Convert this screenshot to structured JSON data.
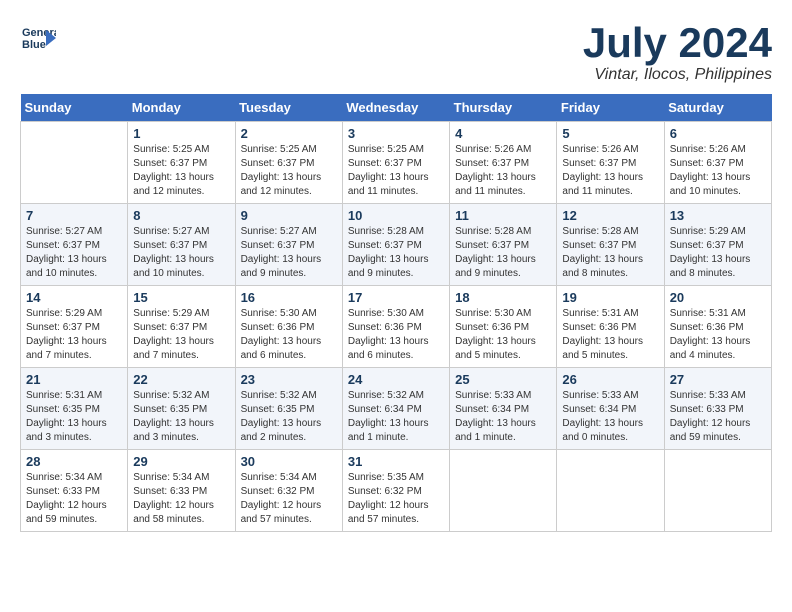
{
  "header": {
    "logo_line1": "General",
    "logo_line2": "Blue",
    "month_year": "July 2024",
    "location": "Vintar, Ilocos, Philippines"
  },
  "days_of_week": [
    "Sunday",
    "Monday",
    "Tuesday",
    "Wednesday",
    "Thursday",
    "Friday",
    "Saturday"
  ],
  "weeks": [
    [
      {
        "day": "",
        "info": ""
      },
      {
        "day": "1",
        "info": "Sunrise: 5:25 AM\nSunset: 6:37 PM\nDaylight: 13 hours\nand 12 minutes."
      },
      {
        "day": "2",
        "info": "Sunrise: 5:25 AM\nSunset: 6:37 PM\nDaylight: 13 hours\nand 12 minutes."
      },
      {
        "day": "3",
        "info": "Sunrise: 5:25 AM\nSunset: 6:37 PM\nDaylight: 13 hours\nand 11 minutes."
      },
      {
        "day": "4",
        "info": "Sunrise: 5:26 AM\nSunset: 6:37 PM\nDaylight: 13 hours\nand 11 minutes."
      },
      {
        "day": "5",
        "info": "Sunrise: 5:26 AM\nSunset: 6:37 PM\nDaylight: 13 hours\nand 11 minutes."
      },
      {
        "day": "6",
        "info": "Sunrise: 5:26 AM\nSunset: 6:37 PM\nDaylight: 13 hours\nand 10 minutes."
      }
    ],
    [
      {
        "day": "7",
        "info": "Sunrise: 5:27 AM\nSunset: 6:37 PM\nDaylight: 13 hours\nand 10 minutes."
      },
      {
        "day": "8",
        "info": "Sunrise: 5:27 AM\nSunset: 6:37 PM\nDaylight: 13 hours\nand 10 minutes."
      },
      {
        "day": "9",
        "info": "Sunrise: 5:27 AM\nSunset: 6:37 PM\nDaylight: 13 hours\nand 9 minutes."
      },
      {
        "day": "10",
        "info": "Sunrise: 5:28 AM\nSunset: 6:37 PM\nDaylight: 13 hours\nand 9 minutes."
      },
      {
        "day": "11",
        "info": "Sunrise: 5:28 AM\nSunset: 6:37 PM\nDaylight: 13 hours\nand 9 minutes."
      },
      {
        "day": "12",
        "info": "Sunrise: 5:28 AM\nSunset: 6:37 PM\nDaylight: 13 hours\nand 8 minutes."
      },
      {
        "day": "13",
        "info": "Sunrise: 5:29 AM\nSunset: 6:37 PM\nDaylight: 13 hours\nand 8 minutes."
      }
    ],
    [
      {
        "day": "14",
        "info": "Sunrise: 5:29 AM\nSunset: 6:37 PM\nDaylight: 13 hours\nand 7 minutes."
      },
      {
        "day": "15",
        "info": "Sunrise: 5:29 AM\nSunset: 6:37 PM\nDaylight: 13 hours\nand 7 minutes."
      },
      {
        "day": "16",
        "info": "Sunrise: 5:30 AM\nSunset: 6:36 PM\nDaylight: 13 hours\nand 6 minutes."
      },
      {
        "day": "17",
        "info": "Sunrise: 5:30 AM\nSunset: 6:36 PM\nDaylight: 13 hours\nand 6 minutes."
      },
      {
        "day": "18",
        "info": "Sunrise: 5:30 AM\nSunset: 6:36 PM\nDaylight: 13 hours\nand 5 minutes."
      },
      {
        "day": "19",
        "info": "Sunrise: 5:31 AM\nSunset: 6:36 PM\nDaylight: 13 hours\nand 5 minutes."
      },
      {
        "day": "20",
        "info": "Sunrise: 5:31 AM\nSunset: 6:36 PM\nDaylight: 13 hours\nand 4 minutes."
      }
    ],
    [
      {
        "day": "21",
        "info": "Sunrise: 5:31 AM\nSunset: 6:35 PM\nDaylight: 13 hours\nand 3 minutes."
      },
      {
        "day": "22",
        "info": "Sunrise: 5:32 AM\nSunset: 6:35 PM\nDaylight: 13 hours\nand 3 minutes."
      },
      {
        "day": "23",
        "info": "Sunrise: 5:32 AM\nSunset: 6:35 PM\nDaylight: 13 hours\nand 2 minutes."
      },
      {
        "day": "24",
        "info": "Sunrise: 5:32 AM\nSunset: 6:34 PM\nDaylight: 13 hours\nand 1 minute."
      },
      {
        "day": "25",
        "info": "Sunrise: 5:33 AM\nSunset: 6:34 PM\nDaylight: 13 hours\nand 1 minute."
      },
      {
        "day": "26",
        "info": "Sunrise: 5:33 AM\nSunset: 6:34 PM\nDaylight: 13 hours\nand 0 minutes."
      },
      {
        "day": "27",
        "info": "Sunrise: 5:33 AM\nSunset: 6:33 PM\nDaylight: 12 hours\nand 59 minutes."
      }
    ],
    [
      {
        "day": "28",
        "info": "Sunrise: 5:34 AM\nSunset: 6:33 PM\nDaylight: 12 hours\nand 59 minutes."
      },
      {
        "day": "29",
        "info": "Sunrise: 5:34 AM\nSunset: 6:33 PM\nDaylight: 12 hours\nand 58 minutes."
      },
      {
        "day": "30",
        "info": "Sunrise: 5:34 AM\nSunset: 6:32 PM\nDaylight: 12 hours\nand 57 minutes."
      },
      {
        "day": "31",
        "info": "Sunrise: 5:35 AM\nSunset: 6:32 PM\nDaylight: 12 hours\nand 57 minutes."
      },
      {
        "day": "",
        "info": ""
      },
      {
        "day": "",
        "info": ""
      },
      {
        "day": "",
        "info": ""
      }
    ]
  ]
}
